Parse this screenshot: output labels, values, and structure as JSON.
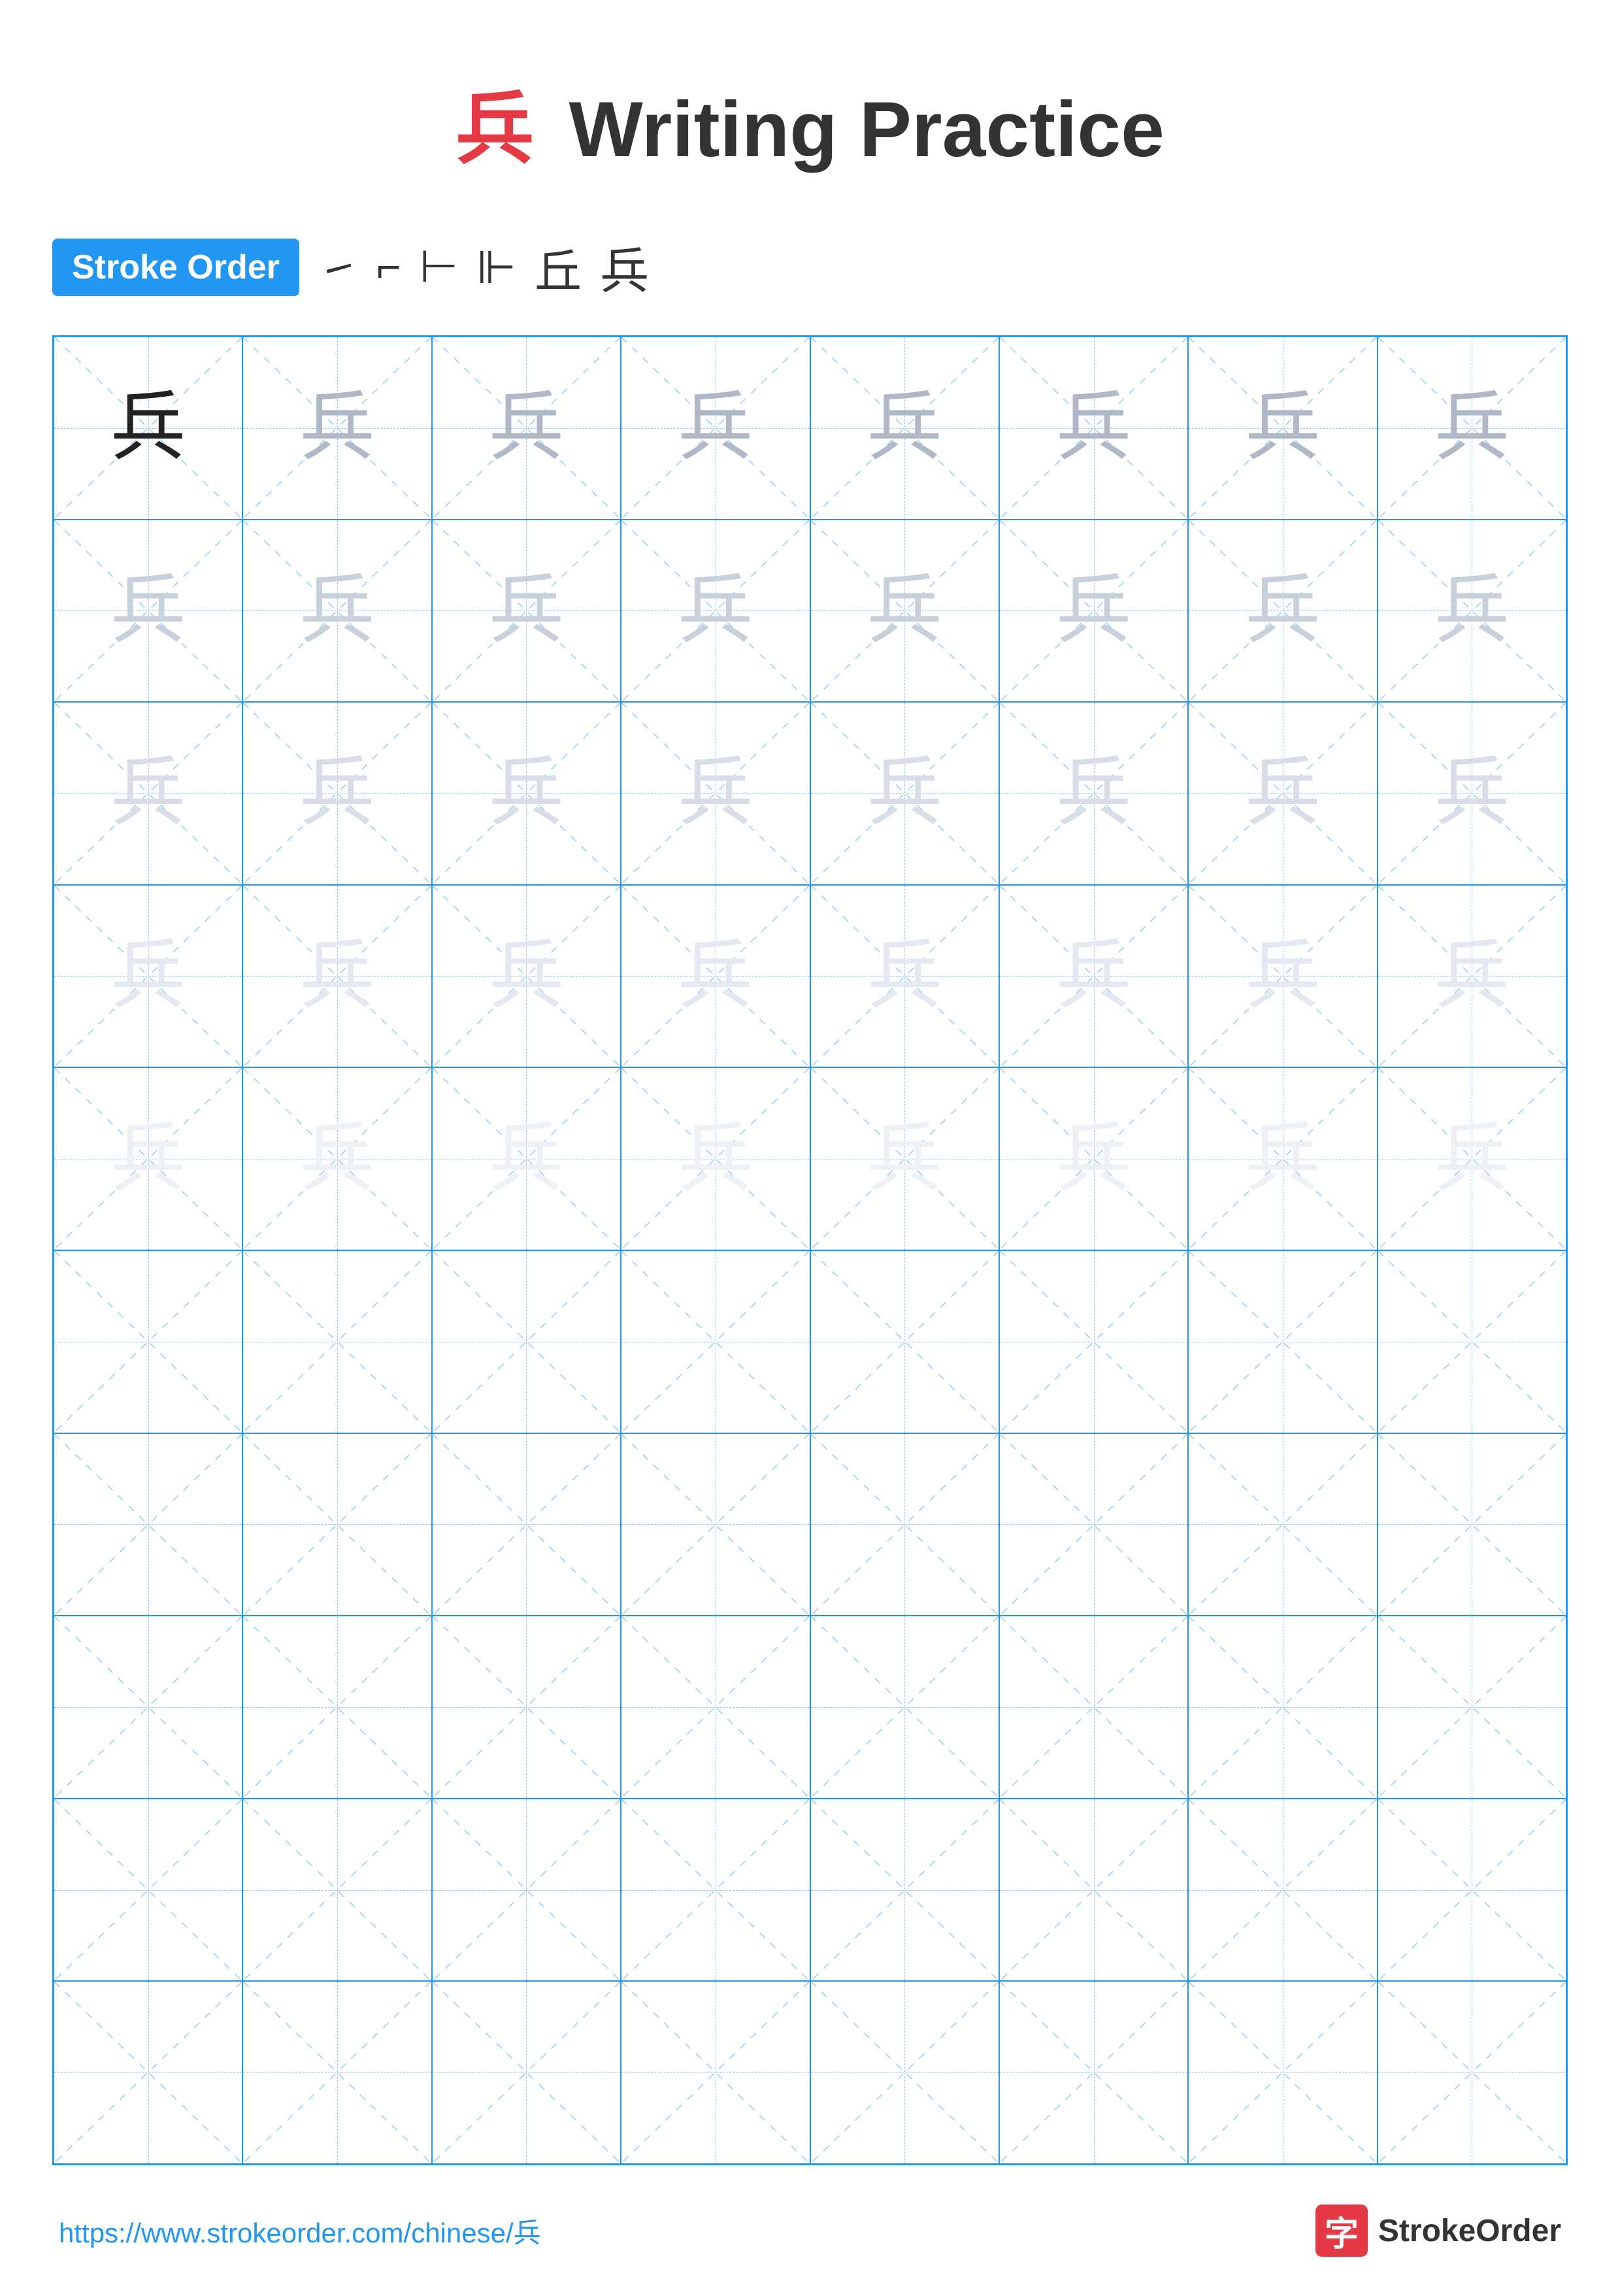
{
  "title": {
    "char": "兵",
    "text": " Writing Practice"
  },
  "stroke_order": {
    "badge": "Stroke Order",
    "strokes": [
      "˙",
      "ㄱ",
      "ㅏ",
      "ㅏ",
      "丘",
      "兵"
    ]
  },
  "grid": {
    "rows": 10,
    "cols": 8,
    "char": "兵",
    "filled_rows": 5
  },
  "footer": {
    "url": "https://www.strokeorder.com/chinese/兵",
    "logo_text": "StrokeOrder",
    "logo_char": "字"
  }
}
